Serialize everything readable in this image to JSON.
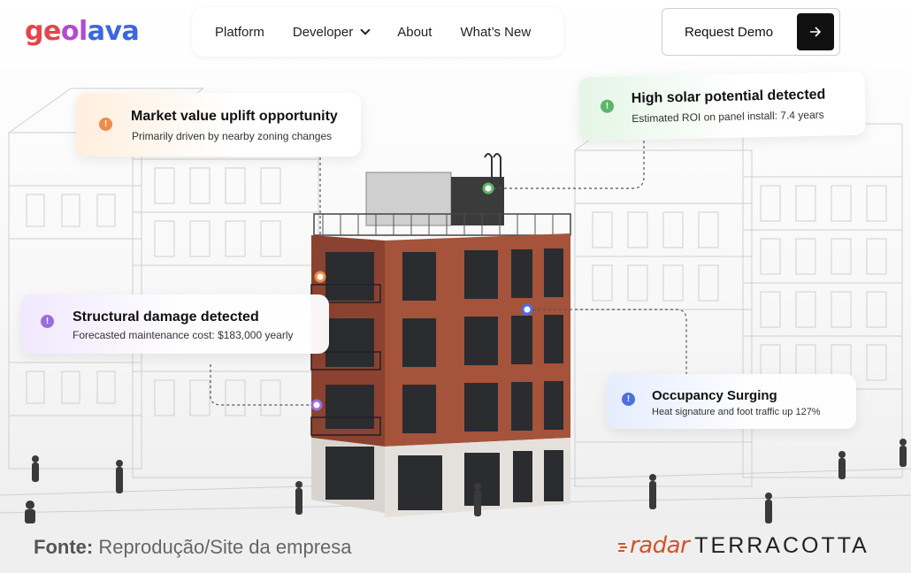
{
  "header": {
    "logo": {
      "part1": "ge",
      "part2": "ol",
      "part3": "ava"
    },
    "nav": [
      {
        "label": "Platform"
      },
      {
        "label": "Developer"
      },
      {
        "label": "About"
      },
      {
        "label": "What’s New"
      }
    ],
    "cta_label": "Request Demo"
  },
  "cards": {
    "market": {
      "title": "Market value uplift opportunity",
      "subtitle": "Primarily driven by nearby zoning changes",
      "icon": "!"
    },
    "solar": {
      "title": "High solar potential detected",
      "subtitle": "Estimated ROI on panel install: 7.4 years",
      "icon": "!"
    },
    "structural": {
      "title": "Structural damage detected",
      "subtitle": "Forecasted maintenance cost: $183,000 yearly",
      "icon": "!"
    },
    "occupancy": {
      "title": "Occupancy Surging",
      "subtitle": "Heat signature and foot traffic up 127%",
      "icon": "!"
    }
  },
  "footer": {
    "credit_label": "Fonte:",
    "credit_text": " Reprodução/Site da empresa",
    "brand_1": "radar",
    "brand_2": "TERRACOTTA"
  },
  "colors": {
    "brick": "#9a4a34",
    "market_dot": "#ef8c4a",
    "solar_dot": "#5cb66a",
    "structural_dot": "#9b6ce0",
    "occupancy_dot": "#4c6fe0",
    "brand_accent": "#d0542c"
  }
}
